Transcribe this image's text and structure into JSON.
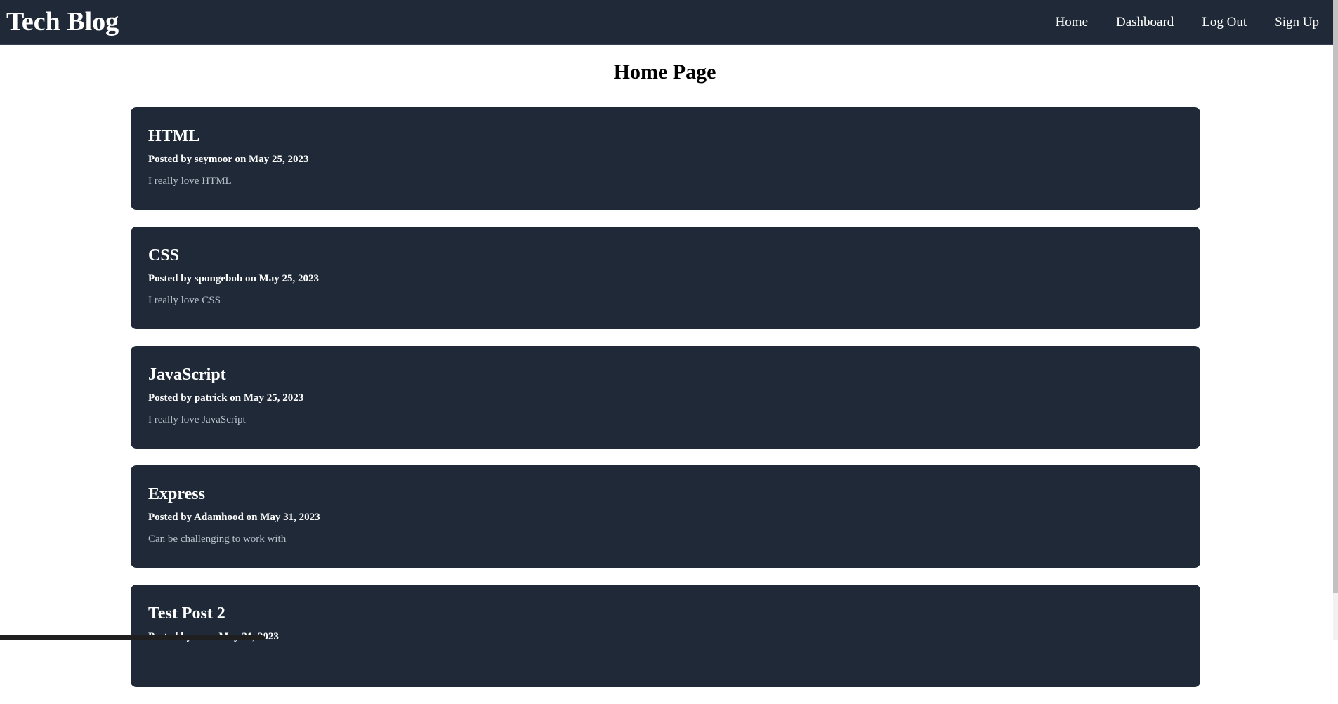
{
  "header": {
    "brand": "Tech Blog",
    "nav": [
      {
        "label": "Home"
      },
      {
        "label": "Dashboard"
      },
      {
        "label": "Log Out"
      },
      {
        "label": "Sign Up"
      }
    ]
  },
  "main": {
    "title": "Home Page",
    "posts": [
      {
        "title": "HTML",
        "meta": "Posted by seymoor on May 25, 2023",
        "body": "I really love HTML"
      },
      {
        "title": "CSS",
        "meta": "Posted by spongebob on May 25, 2023",
        "body": "I really love CSS"
      },
      {
        "title": "JavaScript",
        "meta": "Posted by patrick on May 25, 2023",
        "body": "I really love JavaScript"
      },
      {
        "title": "Express",
        "meta": "Posted by Adamhood on May 31, 2023",
        "body": "Can be challenging to work with"
      },
      {
        "title": "Test Post 2",
        "meta": "Posted by ... on May 31, 2023",
        "body": ""
      }
    ]
  },
  "colors": {
    "navbar_bg": "#1f2937",
    "card_bg": "#1f2937",
    "body_text": "#b8c0cc"
  }
}
